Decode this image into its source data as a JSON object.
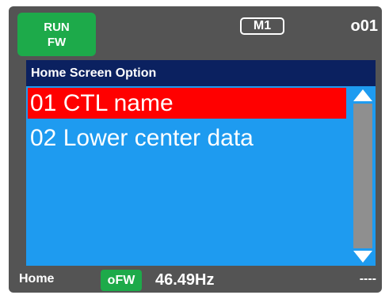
{
  "status": {
    "run_line1": "RUN",
    "run_line2": "FW",
    "mode": "M1",
    "param_code": "o01"
  },
  "menu": {
    "header": "Home Screen Option",
    "items": [
      {
        "label": "01 CTL name",
        "selected": true
      },
      {
        "label": "02 Lower center data",
        "selected": false
      }
    ]
  },
  "footer": {
    "home_label": "Home",
    "direction": "oFW",
    "frequency": "46.49Hz",
    "right_text": "----"
  },
  "colors": {
    "screen_bg": "#545454",
    "run_badge": "#1daa4a",
    "menu_header_bg": "#0b2160",
    "menu_bg": "#1e9bf0",
    "selection": "#ff0000",
    "scroll_track": "#8f8f8f"
  },
  "icons": {
    "scroll_up": "triangle-up-icon",
    "scroll_down": "triangle-down-icon"
  }
}
